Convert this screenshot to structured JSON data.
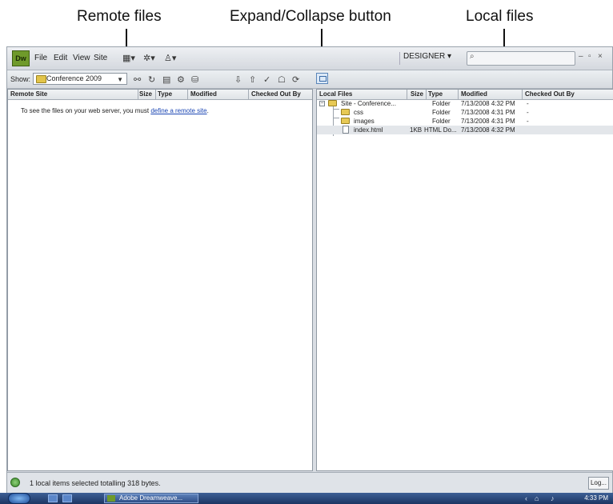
{
  "callouts": {
    "remote": "Remote files",
    "expand": "Expand/Collapse button",
    "local": "Local files"
  },
  "menu": {
    "logo": "Dw",
    "items": [
      "File",
      "Edit",
      "View",
      "Site"
    ],
    "designer": "DESIGNER ▾"
  },
  "toolbar": {
    "show_label": "Show:",
    "site_name": "Conference 2009"
  },
  "remote_pane": {
    "columns": [
      "Remote Site",
      "Size",
      "Type",
      "Modified",
      "Checked Out By"
    ],
    "message": "To see the files on your web server, you must",
    "link": "define a remote site",
    "period": "."
  },
  "local_pane": {
    "columns": [
      "Local Files",
      "Size",
      "Type",
      "Modified",
      "Checked Out By"
    ],
    "rows": [
      {
        "name": "Site - Conference...",
        "size": "",
        "type": "Folder",
        "modified": "7/13/2008 4:32 PM",
        "checked": "-"
      },
      {
        "name": "css",
        "size": "",
        "type": "Folder",
        "modified": "7/13/2008 4:31 PM",
        "checked": "-"
      },
      {
        "name": "images",
        "size": "",
        "type": "Folder",
        "modified": "7/13/2008 4:31 PM",
        "checked": "-"
      },
      {
        "name": "index.html",
        "size": "1KB",
        "type": "HTML Do...",
        "modified": "7/13/2008 4:32 PM",
        "checked": ""
      }
    ]
  },
  "status": {
    "text": "1 local items selected totalling 318 bytes.",
    "log": "Log..."
  },
  "taskbar": {
    "app": "Adobe Dreamweave...",
    "clock": "4:33 PM"
  },
  "icons": {
    "site_folder": "folder-icon",
    "expand": "expand-collapse-icon"
  }
}
